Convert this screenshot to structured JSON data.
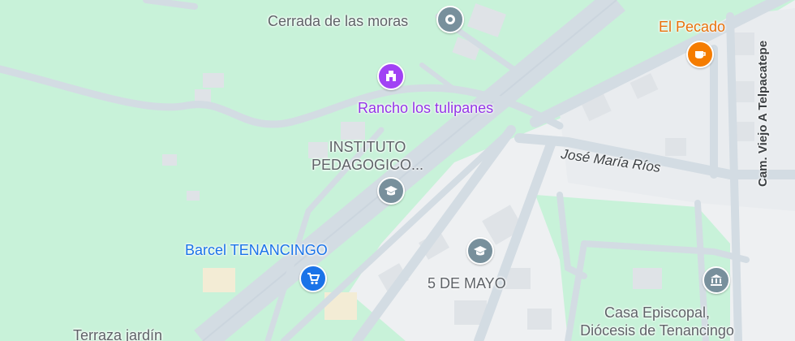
{
  "map": {
    "colors": {
      "background": "#c8f2d9",
      "road": "#d3dce3",
      "urban": "#eef0f2",
      "poi_gray": "#78909c",
      "poi_purple": "#a142f4",
      "poi_orange": "#f57c00",
      "poi_blue": "#1a73e8"
    },
    "places": [
      {
        "id": "cerrada",
        "name": "Cerrada de las moras",
        "icon": "location-icon",
        "color": "gray"
      },
      {
        "id": "rancho",
        "name": "Rancho los tulipanes",
        "icon": "event-venue-icon",
        "color": "purple"
      },
      {
        "id": "instituto",
        "name_line1": "INSTITUTO",
        "name_line2": "PEDAGOGICO...",
        "icon": "school-icon",
        "color": "gray"
      },
      {
        "id": "barcel",
        "name": "Barcel TENANCINGO",
        "icon": "shopping-cart-icon",
        "color": "blue"
      },
      {
        "id": "cinco",
        "name": "5 DE MAYO",
        "icon": "school-icon",
        "color": "gray"
      },
      {
        "id": "pecado",
        "name": "El Pecado",
        "icon": "cafe-icon",
        "color": "orange"
      },
      {
        "id": "casa",
        "name_line1": "Casa Episcopal,",
        "name_line2": "Diócesis de Tenancingo",
        "icon": "government-building-icon",
        "color": "gray"
      },
      {
        "id": "terraza",
        "name": "Terraza jardín"
      }
    ],
    "streets": [
      {
        "id": "jose",
        "name": "José María Ríos"
      },
      {
        "id": "camino",
        "name": "Cam. Viejo A Telpacatepe"
      }
    ]
  }
}
